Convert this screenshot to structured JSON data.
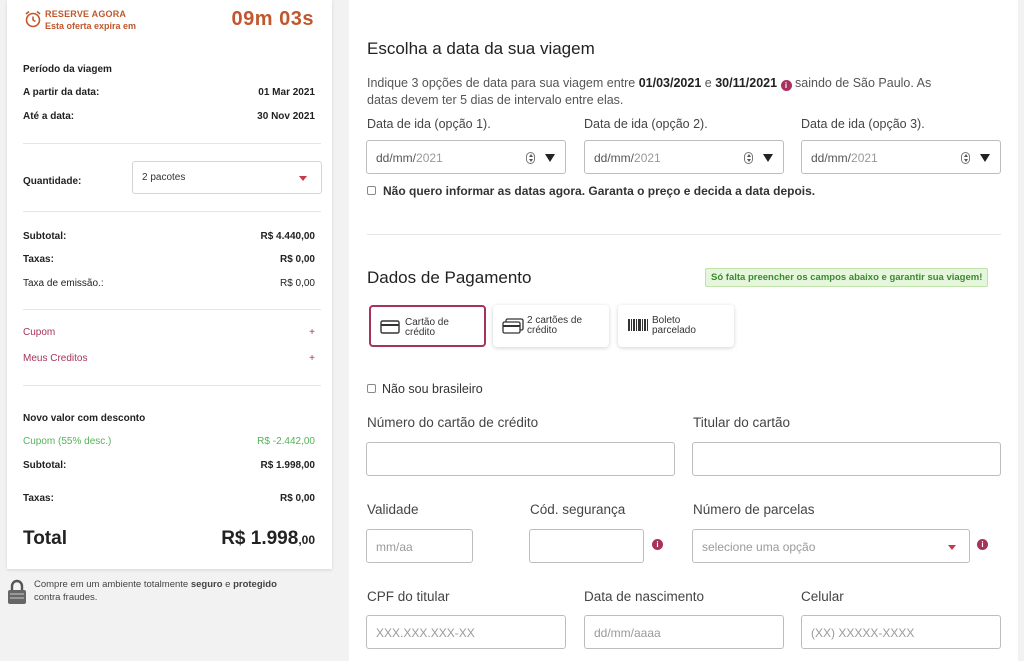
{
  "summary": {
    "reserve_title": "RESERVE AGORA",
    "reserve_sub": "Esta oferta expira em",
    "timer": "09m 03s",
    "period_title": "Período da viagem",
    "from_label": "A partir da data:",
    "from_value": "01 Mar 2021",
    "to_label": "Até a data:",
    "to_value": "30 Nov 2021",
    "qty_label": "Quantidade:",
    "qty_value": "2 pacotes",
    "subtotal_label": "Subtotal:",
    "subtotal_value": "R$ 4.440,00",
    "taxas_label": "Taxas:",
    "taxas_value": "R$ 0,00",
    "emissao_label": "Taxa de emissão.:",
    "emissao_value": "R$ 0,00",
    "cupom_label": "Cupom",
    "creditos_label": "Meus Creditos",
    "plus": "+",
    "new_value_title": "Novo valor com desconto",
    "discount_label": "Cupom (55% desc.)",
    "discount_value": "R$ -2.442,00",
    "subtotal2_label": "Subtotal:",
    "subtotal2_value": "R$ 1.998,00",
    "taxas2_label": "Taxas:",
    "taxas2_value": "R$ 0,00",
    "total_label": "Total",
    "total_main": "R$ 1.998",
    "total_cents": ",00"
  },
  "secure": {
    "t1": "Compre em um ambiente totalmente ",
    "t2": "seguro",
    "t3": " e ",
    "t4": "protegido",
    "t5": "contra fraudes."
  },
  "dates": {
    "title": "Escolha a data da sua viagem",
    "desc_1": "Indique 3 opções de data para sua viagem entre ",
    "desc_d1": "01/03/2021",
    "desc_and": " e ",
    "desc_d2": "30/11/2021",
    "desc_2": " saindo de São Paulo. As",
    "desc_3": "datas devem ter 5 dias de intervalo entre elas.",
    "opt1_label": "Data de ida (opção 1).",
    "opt2_label": "Data de ida (opção 2).",
    "opt3_label": "Data de ida (opção 3).",
    "date_ph_a": "dd/mm/",
    "date_ph_b": "2021",
    "no_date": "Não quero informar as datas agora. Garanta o preço e decida a data depois."
  },
  "payment": {
    "title": "Dados de Pagamento",
    "badge": "Só falta preencher os campos abaixo e garantir sua viagem!",
    "m1_a": "Cartão de",
    "m1_b": "crédito",
    "m2_a": "2 cartões de",
    "m2_b": "crédito",
    "m3_a": "Boleto",
    "m3_b": "parcelado",
    "not_brazilian": "Não sou brasileiro",
    "card_number_label": "Número do cartão de crédito",
    "holder_label": "Titular do cartão",
    "validity_label": "Validade",
    "validity_ph": "mm/aa",
    "cvv_label": "Cód. segurança",
    "installments_label": "Número de parcelas",
    "installments_ph": "selecione uma opção",
    "cpf_label": "CPF do titular",
    "cpf_ph": "XXX.XXX.XXX-XX",
    "birth_label": "Data de nascimento",
    "birth_ph": "dd/mm/aaaa",
    "phone_label": "Celular",
    "phone_ph": "(XX) XXXXX-XXXX",
    "info_glyph": "i"
  },
  "colors": {
    "accent": "#a8325e",
    "timer": "#c1572d",
    "discount": "#55b35a"
  }
}
